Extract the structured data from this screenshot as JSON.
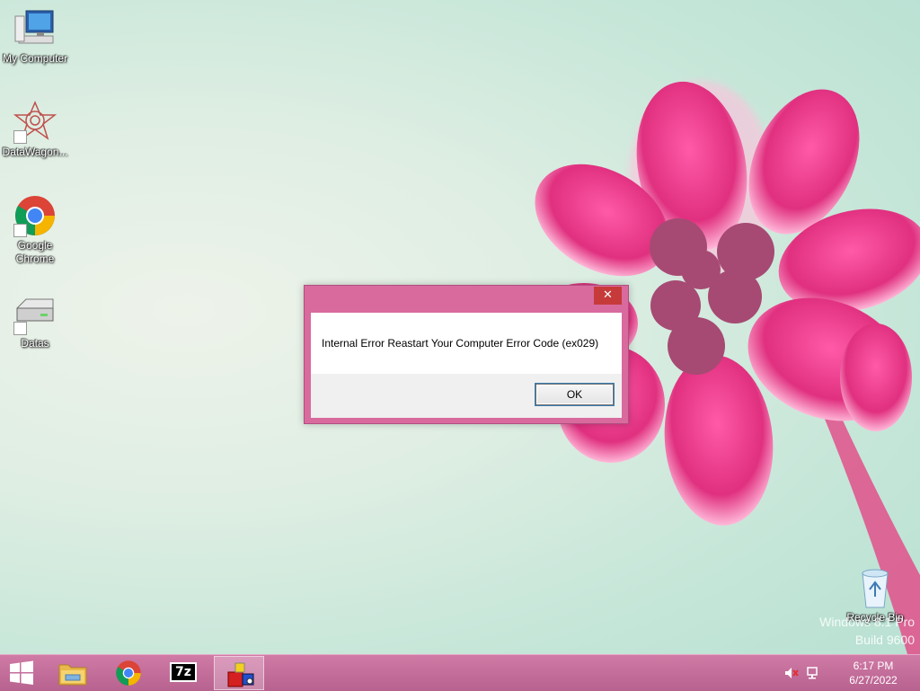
{
  "desktop": {
    "icons": [
      {
        "label": "My Computer",
        "icon": "computer-icon"
      },
      {
        "label": "DataWagon...",
        "icon": "datawagon-icon"
      },
      {
        "label_line1": "Google",
        "label_line2": "Chrome",
        "icon": "chrome-icon"
      },
      {
        "label": "Datas",
        "icon": "drive-icon"
      },
      {
        "label": "Recycle Bin",
        "icon": "recycle-bin-icon"
      }
    ],
    "watermark": {
      "line1": "Windows 8.1 Pro",
      "line2": "Build 9600"
    }
  },
  "dialog": {
    "message": "Internal Error Reastart Your Computer Error Code (ex029)",
    "ok_label": "OK",
    "close_glyph": "✕",
    "accent_color": "#d86a9e"
  },
  "taskbar": {
    "start_icon": "windows-logo-icon",
    "pinned": [
      {
        "name": "file-explorer-icon"
      },
      {
        "name": "chrome-icon"
      },
      {
        "name": "7zip-icon",
        "text": "7z"
      },
      {
        "name": "app-icon",
        "active": true
      }
    ],
    "tray": [
      "volume-muted-icon",
      "network-icon"
    ],
    "clock": {
      "time": "6:17 PM",
      "date": "6/27/2022"
    }
  }
}
